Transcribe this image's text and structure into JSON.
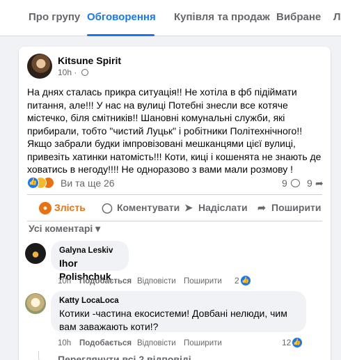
{
  "tabs": [
    {
      "label": "Про групу"
    },
    {
      "label": "Обговорення"
    },
    {
      "label": "Купівля та продаж"
    },
    {
      "label": "Вибране"
    },
    {
      "label": "Л"
    }
  ],
  "post": {
    "author": "Kitsune Spirit",
    "time": "10h",
    "text": "На днях сталась прикра ситуація!! Не хотіла в фб підіймати питання, але!!! У нас на вулиці Потебні знесли все котяче містечко, біля смітників!! Шановні комунальні служби, які прибирали, тобто \"чистий Луцьк\" і робітники Політехнічного!! Якщо забрали будки імпровізовані мешканцями цієї вулиці, привезіть хатинки натомість!!! Коти, киці і кошенята не знають де ховатись в негоду!!!! Не одноразово з вами мали розмову !",
    "reactions_text": "Ви та ще 26",
    "comments_count": "9",
    "shares_count": "9",
    "icons": {
      "like": "thumbs-up-icon",
      "sad": "sad-face-icon",
      "angry": "angry-face-icon",
      "comment": "comment-bubble-icon",
      "share": "share-arrow-icon",
      "privacy": "globe-icon"
    }
  },
  "actions": {
    "react_label": "Злість",
    "comment_label": "Коментувати",
    "send_label": "Надіслати",
    "share_label": "Поширити"
  },
  "comments_section": {
    "sort_label": "Усі коментарі",
    "more_replies": "Переглянути всі 2 відповіді"
  },
  "comments": [
    {
      "author": "Galyna Leskiv",
      "text": "Ihor Polishchuk",
      "time": "10h",
      "like_label": "Подобається",
      "reply_label": "Відповісти",
      "share_label": "Поширити",
      "likes": "2"
    },
    {
      "author": "Katty LocaLoca",
      "text": "Котики -частина екосистеми! Довбані нелюди, чим вам заважають коти!?",
      "time": "10h",
      "like_label": "Подобається",
      "reply_label": "Відповісти",
      "share_label": "Поширити",
      "likes": "12"
    }
  ],
  "colors": {
    "accent": "#1877f2",
    "angry": "#e9710f",
    "muted_text": "#65676b",
    "page_bg": "#f0f2f5"
  }
}
